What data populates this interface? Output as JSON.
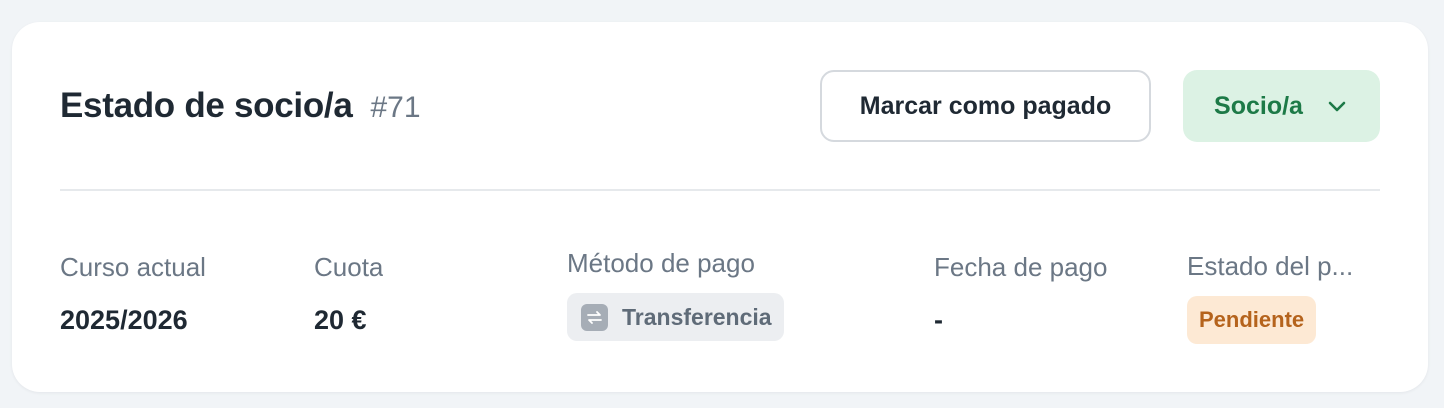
{
  "header": {
    "title": "Estado de socio/a",
    "id": "#71",
    "mark_paid_label": "Marcar como pagado",
    "status_dropdown_label": "Socio/a"
  },
  "fields": {
    "course": {
      "label": "Curso actual",
      "value": "2025/2026"
    },
    "fee": {
      "label": "Cuota",
      "value": "20 €"
    },
    "payment_method": {
      "label": "Método de pago",
      "value": "Transferencia",
      "icon": "transfer-icon"
    },
    "payment_date": {
      "label": "Fecha de pago",
      "value": "-"
    },
    "payment_status": {
      "label": "Estado del p...",
      "value": "Pendiente"
    }
  },
  "colors": {
    "status_dropdown_bg": "#dcf2e4",
    "status_dropdown_text": "#1d7a47",
    "pending_bg": "#fde9d4",
    "pending_text": "#b5631c"
  }
}
